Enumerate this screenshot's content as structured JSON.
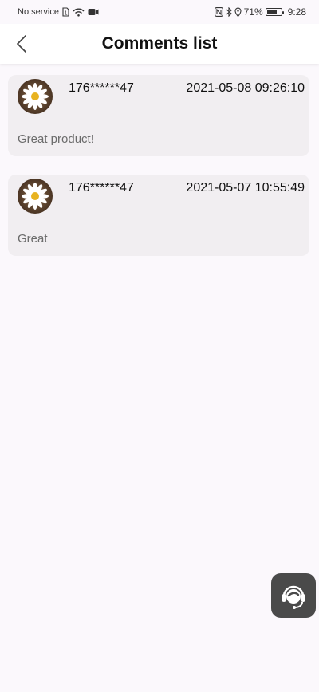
{
  "status_bar": {
    "carrier": "No service",
    "battery_percent": "71%",
    "battery_level": 0.71,
    "time": "9:28"
  },
  "header": {
    "title": "Comments list",
    "back_icon": "chevron-left-icon"
  },
  "comments": [
    {
      "user": "176******47",
      "timestamp": "2021-05-08 09:26:10",
      "text": "Great product!",
      "avatar_icon": "daisy-avatar"
    },
    {
      "user": "176******47",
      "timestamp": "2021-05-07 10:55:49",
      "text": "Great",
      "avatar_icon": "daisy-avatar"
    }
  ],
  "support": {
    "icon": "customer-service-headset-icon"
  },
  "colors": {
    "background": "#fbf8fc",
    "card": "#f1eef1",
    "support_button": "#4a4a4a"
  }
}
